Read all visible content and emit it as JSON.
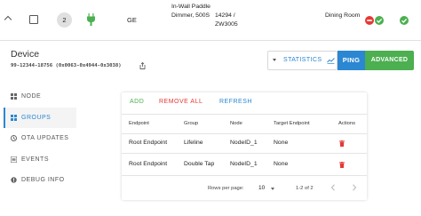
{
  "device_row": {
    "node_id": "2",
    "manufacturer": "GE",
    "product": "In-Wall Paddle Dimmer, 500S",
    "product_code": "14294 / ZW3005",
    "location": "Dining Room"
  },
  "device": {
    "title": "Device",
    "subtitle": "99-12344-18756 (0x0063-0x4944-0x3038)"
  },
  "toolbar": {
    "statistics_label": "STATISTICS",
    "ping_label": "PING",
    "advanced_label": "ADVANCED"
  },
  "nav": {
    "items": [
      {
        "label": "NODE",
        "icon": "grid-icon"
      },
      {
        "label": "GROUPS",
        "icon": "groups-icon"
      },
      {
        "label": "OTA UPDATES",
        "icon": "update-icon"
      },
      {
        "label": "EVENTS",
        "icon": "list-icon"
      },
      {
        "label": "DEBUG INFO",
        "icon": "bug-icon"
      }
    ],
    "active": "GROUPS"
  },
  "groups": {
    "actions": {
      "add": "ADD",
      "remove_all": "REMOVE ALL",
      "refresh": "REFRESH"
    },
    "columns": [
      "Endpoint",
      "Group",
      "Node",
      "Target Endpoint",
      "Actions"
    ],
    "rows": [
      {
        "endpoint": "Root Endpoint",
        "group": "Lifeline",
        "node": "NodeID_1",
        "target": "None"
      },
      {
        "endpoint": "Root Endpoint",
        "group": "Double Tap",
        "node": "NodeID_1",
        "target": "None"
      }
    ],
    "pagination": {
      "rows_per_page_label": "Rows per page:",
      "rows_per_page": "10",
      "range": "1-2 of 2"
    }
  },
  "colors": {
    "accent_blue": "#2b87d1",
    "green": "#4caf50",
    "red": "#e53935"
  }
}
